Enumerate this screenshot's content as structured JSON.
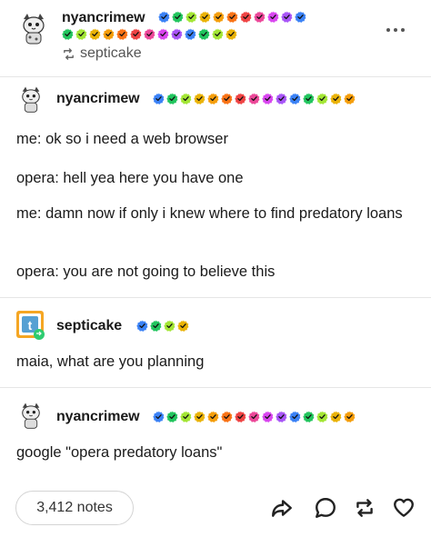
{
  "header": {
    "username": "nyancrimew",
    "reblog_from": "septicake",
    "avatar": "cat-avatar",
    "more_icon": "ellipsis-icon",
    "badge_colors_row1": [
      "#3b82f6",
      "#22c55e",
      "#a3e635",
      "#eab308",
      "#f59e0b",
      "#f97316",
      "#ef4444",
      "#ec4899",
      "#d946ef",
      "#a855f7",
      "#3b82f6"
    ],
    "badge_colors_row2": [
      "#22c55e",
      "#a3e635",
      "#eab308",
      "#f59e0b",
      "#f97316",
      "#ef4444",
      "#ec4899",
      "#d946ef",
      "#a855f7",
      "#3b82f6",
      "#22c55e",
      "#a3e635",
      "#eab308"
    ]
  },
  "thread": [
    {
      "username": "nyancrimew",
      "avatar": "cat-avatar",
      "badge_colors": [
        "#3b82f6",
        "#22c55e",
        "#a3e635",
        "#eab308",
        "#f59e0b",
        "#f97316",
        "#ef4444",
        "#ec4899",
        "#d946ef",
        "#a855f7",
        "#3b82f6",
        "#22c55e",
        "#a3e635",
        "#eab308",
        "#f59e0b"
      ],
      "paragraphs": [
        "me: ok so i need a web browser",
        "opera: hell yea here you have one",
        "me: damn now if only i knew where to find predatory loans",
        "opera: you are not going to believe this"
      ]
    },
    {
      "username": "septicake",
      "avatar": "tumblr-t-avatar",
      "badge_colors": [
        "#3b82f6",
        "#22c55e",
        "#a3e635",
        "#eab308"
      ],
      "paragraphs": [
        "maia, what are you planning"
      ]
    },
    {
      "username": "nyancrimew",
      "avatar": "cat-avatar",
      "badge_colors": [
        "#3b82f6",
        "#22c55e",
        "#a3e635",
        "#eab308",
        "#f59e0b",
        "#f97316",
        "#ef4444",
        "#ec4899",
        "#d946ef",
        "#a855f7",
        "#3b82f6",
        "#22c55e",
        "#a3e635",
        "#eab308",
        "#f59e0b"
      ],
      "paragraphs": [
        "google \"opera predatory loans\""
      ]
    }
  ],
  "footer": {
    "notes_label": "3,412 notes",
    "actions": [
      "share-icon",
      "reply-icon",
      "reblog-icon",
      "like-icon"
    ]
  },
  "colors": {
    "text": "#1a1a1a",
    "muted": "#555555",
    "divider": "#e6e6e6",
    "reblog_green": "#2ecc71",
    "tumblr_blue": "#56a0d3",
    "tumblr_orange": "#f5a623"
  }
}
